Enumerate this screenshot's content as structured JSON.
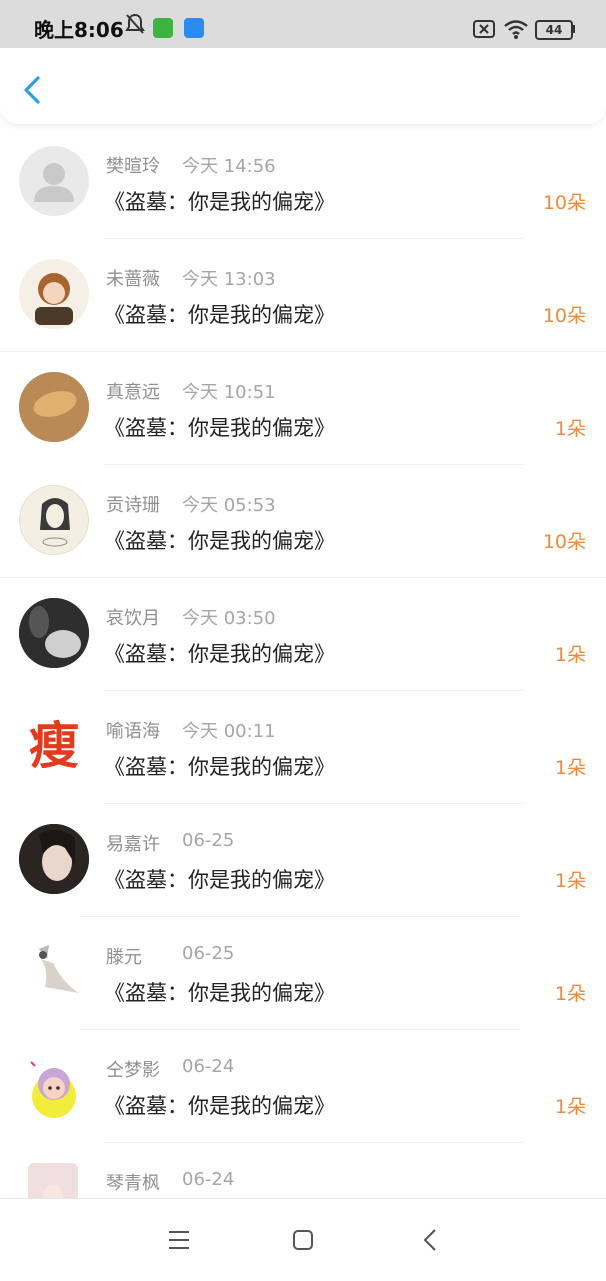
{
  "status": {
    "time": "晚上8:06",
    "battery": "44"
  },
  "header": {
    "back_icon": "chevron-left-icon"
  },
  "colors": {
    "accent": "#2f9ee8",
    "count": "#ee8a3d"
  },
  "rows": [
    {
      "name": "樊暄玲",
      "time": "今天 14:56",
      "book": "《盗墓：你是我的偏宠》",
      "count": "10朵",
      "avatar": "default-avatar"
    },
    {
      "name": "未蔷薇",
      "time": "今天 13:03",
      "book": "《盗墓：你是我的偏宠》",
      "count": "10朵",
      "avatar": "anime-avatar"
    },
    {
      "name": "真意远",
      "time": "今天 10:51",
      "book": "《盗墓：你是我的偏宠》",
      "count": "1朵",
      "avatar": "food-avatar"
    },
    {
      "name": "贡诗珊",
      "time": "今天 05:53",
      "book": "《盗墓：你是我的偏宠》",
      "count": "10朵",
      "avatar": "sketch-avatar"
    },
    {
      "name": "哀饮月",
      "time": "今天 03:50",
      "book": "《盗墓：你是我的偏宠》",
      "count": "1朵",
      "avatar": "photo-avatar"
    },
    {
      "name": "喻语海",
      "time": "今天 00:11",
      "book": "《盗墓：你是我的偏宠》",
      "count": "1朵",
      "avatar": "text-avatar"
    },
    {
      "name": "易嘉许",
      "time": "06-25",
      "book": "《盗墓：你是我的偏宠》",
      "count": "1朵",
      "avatar": "photo-avatar"
    },
    {
      "name": "滕元",
      "time": "06-25",
      "book": "《盗墓：你是我的偏宠》",
      "count": "1朵",
      "avatar": "illustration-avatar"
    },
    {
      "name": "仝梦影",
      "time": "06-24",
      "book": "《盗墓：你是我的偏宠》",
      "count": "1朵",
      "avatar": "cartoon-avatar"
    },
    {
      "name": "琴青枫",
      "time": "06-24",
      "book": "",
      "count": "",
      "avatar": "photo-avatar"
    }
  ],
  "avatar_text": "瘦",
  "navbar": {
    "icons": [
      "menu-icon",
      "home-square-icon",
      "back-triangle-icon"
    ]
  }
}
